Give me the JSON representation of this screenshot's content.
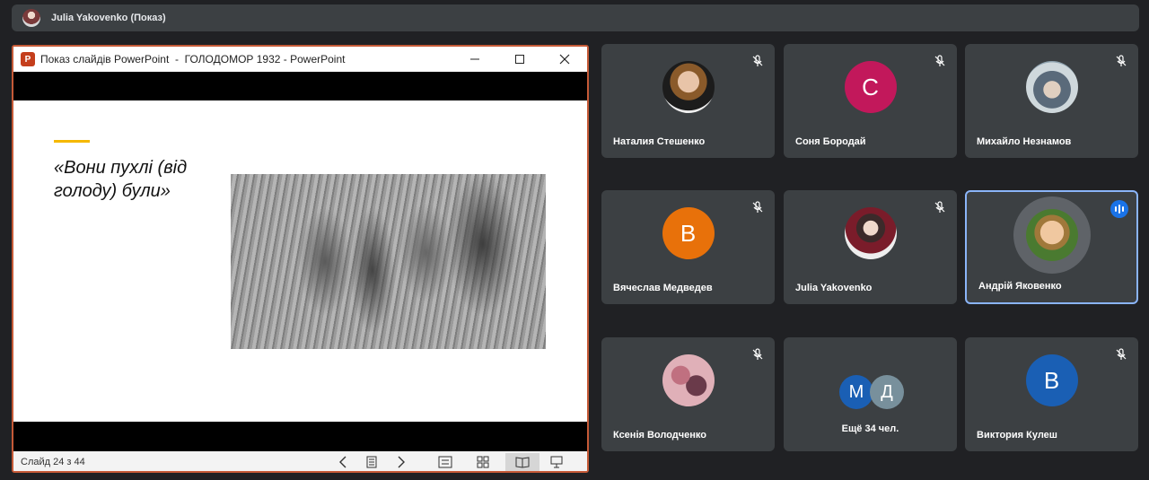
{
  "topbar": {
    "presenter_label": "Julia Yakovenko (Показ)"
  },
  "powerpoint": {
    "app_icon_letter": "P",
    "window_title": "Показ слайдів PowerPoint  -  ГОЛОДОМОР 1932 - PowerPoint",
    "slide": {
      "quote": "«Вони пухлі (від голоду) були»"
    },
    "status": {
      "slide_counter": "Слайд 24 з 44"
    }
  },
  "participants": [
    {
      "name": "Наталия Стешенко",
      "avatar_type": "photo",
      "muted": true
    },
    {
      "name": "Соня Бородай",
      "avatar_letter": "С",
      "avatar_color": "#c2185b",
      "muted": true
    },
    {
      "name": "Михайло Незнамов",
      "avatar_type": "photo",
      "muted": true
    },
    {
      "name": "Вячеслав Медведев",
      "avatar_letter": "В",
      "avatar_color": "#e8710a",
      "muted": true
    },
    {
      "name": "Julia Yakovenko",
      "avatar_type": "photo",
      "muted": true
    },
    {
      "name": "Андрій Яковенко",
      "avatar_type": "photo",
      "speaking": true
    },
    {
      "name": "Ксенія Володченко",
      "avatar_type": "photo",
      "muted": true
    },
    {
      "more_label": "Ещё 34 чел.",
      "avatars": [
        {
          "letter": "М",
          "color": "#1a5fb4"
        },
        {
          "letter": "Д",
          "color": "#78909c"
        }
      ]
    },
    {
      "name": "Виктория Кулеш",
      "avatar_letter": "В",
      "avatar_color": "#1a5fb4",
      "muted": true
    }
  ],
  "colors": {
    "background": "#202124",
    "tile": "#3c4043",
    "speaking_border": "#8ab4f8",
    "ppt_border": "#c55a37"
  }
}
